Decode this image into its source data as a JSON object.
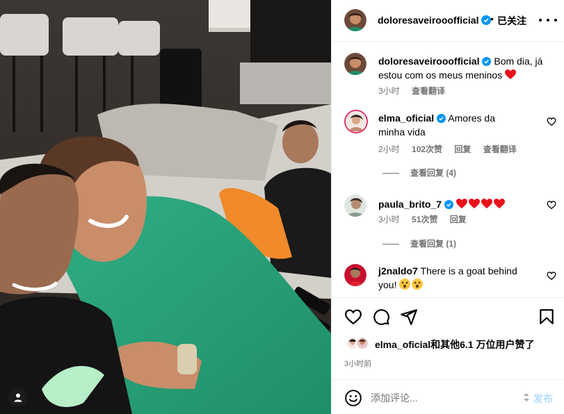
{
  "post": {
    "author": "doloresaveirooofficial",
    "separator": "•",
    "follow_label": "已关注"
  },
  "comments": [
    {
      "user": "doloresaveirooofficial",
      "verified": true,
      "text": "Bom dia, já estou com os meus meninos",
      "emoji": "heart",
      "time": "3小时",
      "translate": "查看翻译"
    },
    {
      "user": "elma_oficial",
      "verified": true,
      "text": "Amores da minha vida",
      "time": "2小时",
      "likes": "102次赞",
      "reply": "回复",
      "translate": "查看翻译",
      "view_replies": "查看回复 (4)"
    },
    {
      "user": "paula_brito_7",
      "verified": true,
      "text": "",
      "emoji_count": 4,
      "time": "3小时",
      "likes": "51次赞",
      "reply": "回复",
      "view_replies": "查看回复 (1)"
    },
    {
      "user": "j2naldo7",
      "verified": false,
      "text": "There is a goat behind you!",
      "emoji": "astonished x2"
    }
  ],
  "likes_summary": "elma_oficial和其他6.1 万位用户赞了",
  "time_ago": "3小时前",
  "add_comment": {
    "placeholder": "添加评论...",
    "post_label": "发布"
  },
  "colors": {
    "verified": "#0095f6",
    "heart": "#ff3040",
    "muted": "#737373",
    "post_disabled": "#b3dbff"
  },
  "icons": [
    "user-tag-icon",
    "more-icon",
    "heart-icon",
    "comment-icon",
    "share-icon",
    "bookmark-icon",
    "emoji-icon"
  ]
}
